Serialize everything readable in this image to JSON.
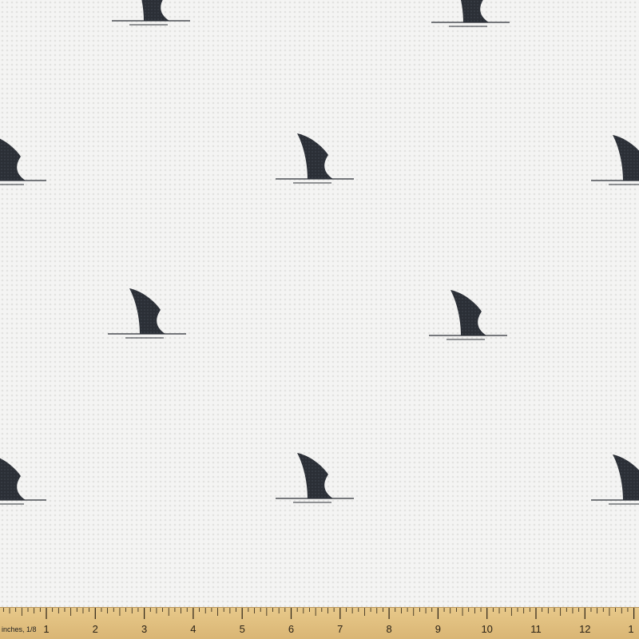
{
  "fabric": {
    "background_color": "#f4f4f3",
    "texture_color": "#dcdcda",
    "motif_icon": "shark-fin-icon",
    "motif_color": "#2b2f36",
    "wave_color": "#2b2f36"
  },
  "ruler": {
    "unit_label": "inches, 1/8",
    "numbers": [
      "1",
      "2",
      "3",
      "4",
      "5",
      "6",
      "7",
      "8",
      "9",
      "10",
      "11",
      "12",
      "1"
    ],
    "color": "#ddbb7a",
    "tick_color": "#2a2217"
  }
}
